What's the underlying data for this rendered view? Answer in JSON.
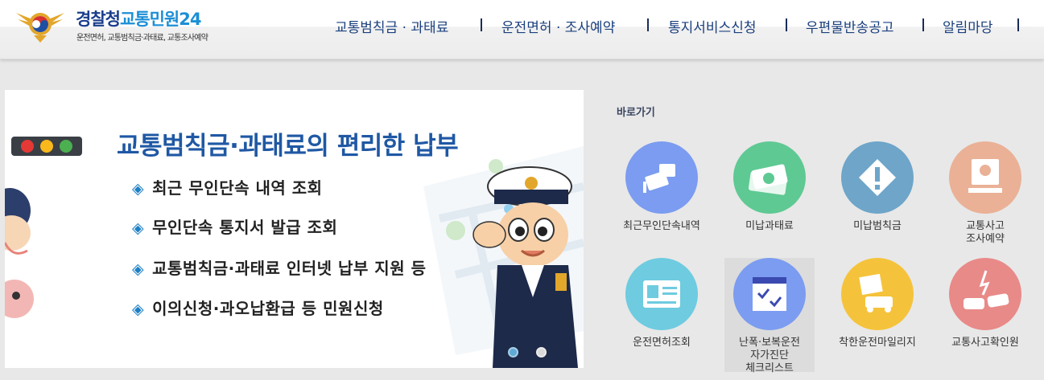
{
  "header": {
    "logo_main": "경찰청",
    "logo_sub_brand": "교통민원24",
    "logo_subtitle": "운전면허, 교통범칙금·과태료, 교통조사예약",
    "nav": [
      {
        "label": "교통범칙금 · 과태료"
      },
      {
        "label": "운전면허 · 조사예약"
      },
      {
        "label": "통지서비스신청"
      },
      {
        "label": "우편물반송공고"
      },
      {
        "label": "알림마당"
      }
    ]
  },
  "banner": {
    "title": "교통범칙금·과태료의 편리한 납부",
    "bullets": [
      "최근 무인단속 내역 조회",
      "무인단속 통지서 발급 조회",
      "교통범칙금·과태료 인터넷 납부 지원 등",
      "이의신청·과오납환급 등 민원신청"
    ],
    "active_slide": 1,
    "slide_count": 2
  },
  "quick": {
    "title": "바로가기",
    "items": [
      {
        "name": "recent-enforcement",
        "icon": "camera-icon",
        "color": "#7b9cf0",
        "lines": [
          "최근무인단속내역"
        ]
      },
      {
        "name": "unpaid-fine",
        "icon": "money-icon",
        "color": "#5ec993",
        "lines": [
          "미납과태료"
        ]
      },
      {
        "name": "unpaid-penalty",
        "icon": "warning-icon",
        "color": "#6ea5c9",
        "lines": [
          "미납범칙금"
        ]
      },
      {
        "name": "accident-reservation",
        "icon": "monitor-icon",
        "color": "#eab196",
        "lines": [
          "교통사고",
          "조사예약"
        ]
      },
      {
        "name": "license-lookup",
        "icon": "id-card-icon",
        "color": "#6ecbe0",
        "lines": [
          "운전면허조회"
        ]
      },
      {
        "name": "reckless-checklist",
        "icon": "calendar-icon",
        "color": "#7b9cf0",
        "lines": [
          "난폭·보복운전",
          "자가진단",
          "체크리스트"
        ]
      },
      {
        "name": "good-driving-mileage",
        "icon": "car-sign-icon",
        "color": "#f5c33b",
        "lines": [
          "착한운전마일리지"
        ]
      },
      {
        "name": "accident-check",
        "icon": "crash-icon",
        "color": "#e88a88",
        "lines": [
          "교통사고확인원"
        ]
      }
    ]
  }
}
